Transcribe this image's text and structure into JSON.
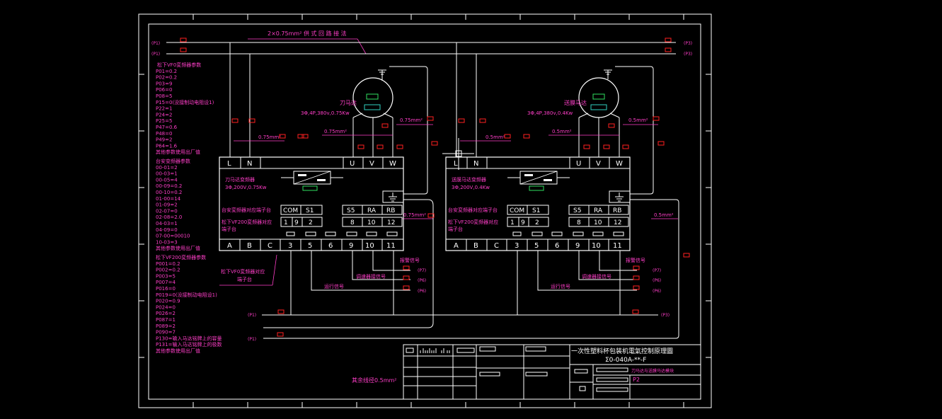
{
  "cable_note": "2×0.75mm² 供 式 回 路 接 法",
  "bus_labels": {
    "p1": "(P1)",
    "p2": "(P2)",
    "p3": "(P3)",
    "p7": "(P7)",
    "p6": "(P6)"
  },
  "left_params": {
    "vf0_title": "松下VF0変频器参数",
    "vf0_lines": [
      "P01=0.2",
      "P02=0.2",
      "P03=9",
      "P06=0",
      "P08=5",
      "P15=0(没接制动电阻设1)",
      "P22=1",
      "P24=2",
      "P25=5",
      "P47=0.6",
      "P48=0",
      "P49=2",
      "P64=1.6"
    ],
    "vf0_foot": "其他参数使用出厂值",
    "tai_title": "台安变频器参数",
    "tai_lines": [
      "00-01=2",
      "00-03=1",
      "00-05=4",
      "00-09=0.2",
      "00-10=0.2",
      "01-00=14",
      "01-09=2",
      "02-07=0",
      "02-08=2.0",
      "04-03=1",
      "04-09=0",
      "07-00=00010",
      "10-03=3"
    ],
    "tai_foot": "其他参数使用出厂值",
    "vf200_title": "松下VF200変频器参数",
    "vf200_lines": [
      "P001=0.2",
      "P002=0.2",
      "P003=5",
      "P007=4",
      "P016=0",
      "P019=0(没接制动电阻设1)",
      "P020=0.9",
      "P024=0",
      "P026=2",
      "P087=1",
      "P089=2",
      "P090=7",
      "P130=输入马达铭牌上的容量",
      "P131=输入马达铭牌上的极数"
    ],
    "vf200_foot": "其他参数使用出厂值"
  },
  "unit1": {
    "motor_label": "刀马达",
    "motor_spec": "3Φ,4P,380v,0.75Kw",
    "vfd_label": "刀马达变频器",
    "vfd_spec": "3Φ,200V,0.75Kw",
    "wire_a": "0.75mm²",
    "wire_b": "0.75mm²",
    "wire_c": "0.75mm²",
    "wire_d": "0.75mm²",
    "wire_e": "0.75mm²"
  },
  "unit2": {
    "motor_label": "送膜马达",
    "motor_spec": "3Φ,4P,380v,0.4Kw",
    "vfd_label": "送膜马达变频器",
    "vfd_spec": "3Φ,200V,0.4Kw",
    "wire_a": "0.5mm²",
    "wire_b": "0.5mm²",
    "wire_c": "0.5mm²",
    "wire_d": "0.5mm²",
    "wire_e": "0.5mm²"
  },
  "terminals": {
    "top_left": [
      "L",
      "N"
    ],
    "top_right": [
      "U",
      "V",
      "W"
    ],
    "mid_left": [
      "COM",
      "S1"
    ],
    "mid_right": [
      "S5",
      "RA",
      "RB"
    ],
    "num_left": [
      "1",
      "9",
      "2"
    ],
    "num_right": [
      "8",
      "10",
      "12"
    ],
    "bottom": [
      "A",
      "B",
      "C",
      "3",
      "5",
      "6",
      "9",
      "10",
      "11"
    ]
  },
  "row_labels": {
    "tai": "台安変频器对应端子台",
    "vf200_a": "松下VF200変频器对应",
    "vf200_b": "端子台",
    "vf0_a": "松下VF0変频器对应",
    "vf0_b": "端子台"
  },
  "signals": {
    "alarm": "报警信号",
    "speed": "调速器接信号",
    "run": "运行信号"
  },
  "other_wire": "其余线径0.5mm²",
  "title_block": {
    "title": "一次性塑料杯包装机電氣控制原理圖",
    "drawing_no": "Σ0-040A-**-F",
    "subtitle": "刀马达与送膜马达模块",
    "sheet": "P2"
  },
  "colors": {
    "magenta": "#ff3ec8",
    "red": "#ff2020",
    "white": "#ffffff",
    "green": "#30e060",
    "cyan": "#30d0c0"
  }
}
